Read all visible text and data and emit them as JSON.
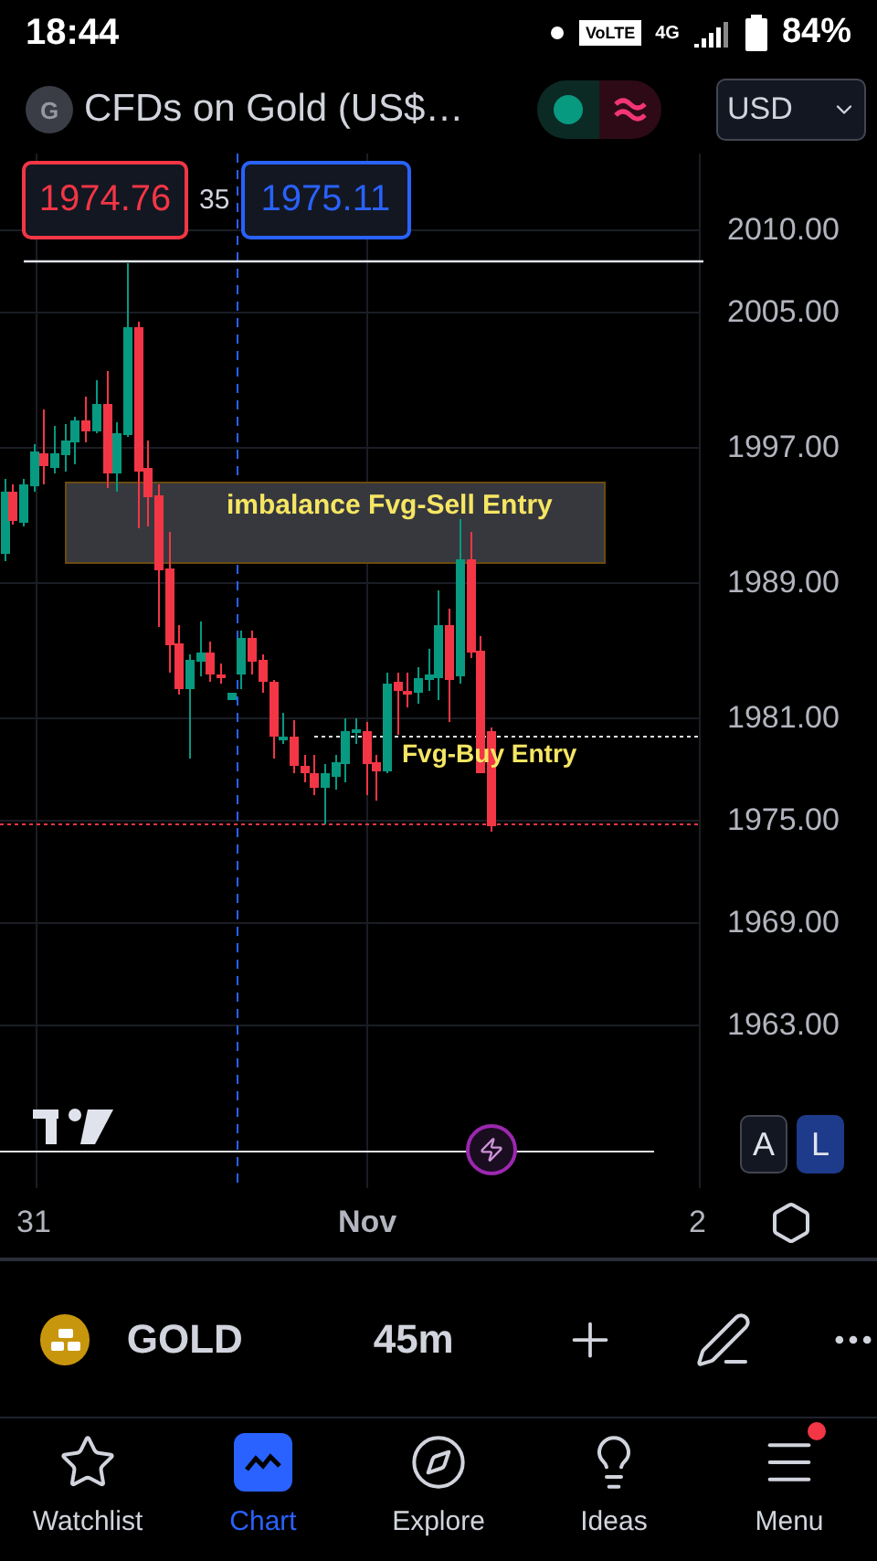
{
  "status_bar": {
    "time": "18:44",
    "network_badge": "VoLTE",
    "network": "4G",
    "battery": "84%"
  },
  "header": {
    "avatar_letter": "G",
    "title": "CFDs on Gold (US$…",
    "currency": "USD"
  },
  "quote": {
    "sell": "1974.76",
    "spread": "35",
    "buy": "1975.11"
  },
  "chart": {
    "price_axis": [
      "2010.00",
      "2005.00",
      "1997.00",
      "1989.00",
      "1981.00",
      "1975.00",
      "1969.00",
      "1963.00"
    ],
    "annotations": [
      {
        "kind": "zone",
        "text": "imbalance Fvg-Sell Entry"
      },
      {
        "kind": "line",
        "text": "Fvg-Buy Entry"
      }
    ],
    "scale_buttons": [
      {
        "label": "A",
        "selected": false
      },
      {
        "label": "L",
        "selected": true
      }
    ],
    "time_axis": [
      "31",
      "Nov",
      "2"
    ]
  },
  "toolbar": {
    "symbol": "GOLD",
    "interval": "45m"
  },
  "nav": [
    {
      "kind": "star",
      "label": "Watchlist",
      "selected": false,
      "notification": false
    },
    {
      "kind": "chart",
      "label": "Chart",
      "selected": true,
      "notification": false
    },
    {
      "kind": "compass",
      "label": "Explore",
      "selected": false,
      "notification": false
    },
    {
      "kind": "bulb",
      "label": "Ideas",
      "selected": false,
      "notification": false
    },
    {
      "kind": "menu",
      "label": "Menu",
      "selected": false,
      "notification": true
    }
  ]
}
